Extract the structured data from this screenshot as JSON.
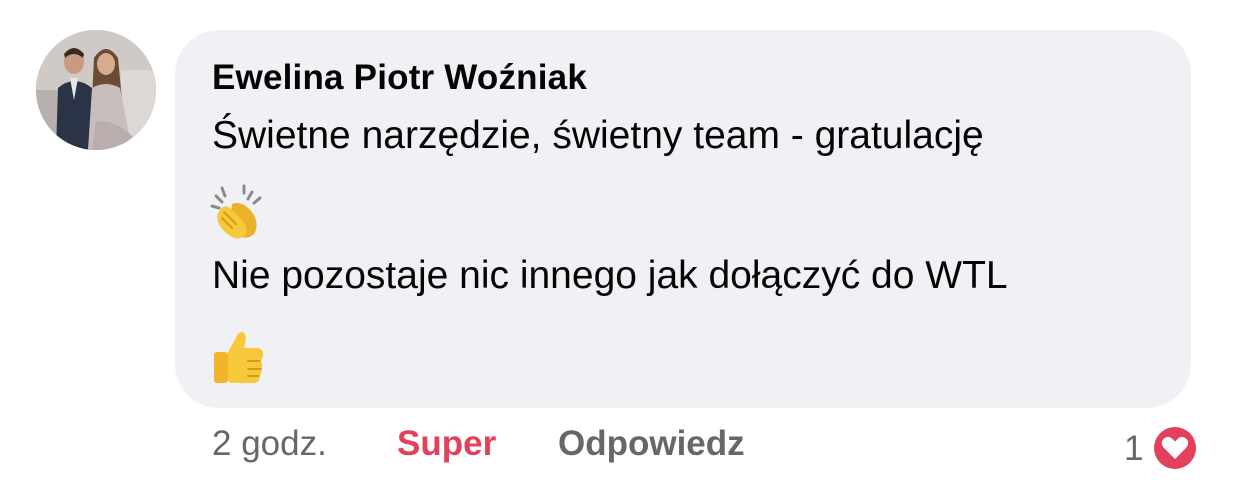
{
  "comment": {
    "author": "Ewelina Piotr Woźniak",
    "line1": "Świetne narzędzie, świetny team - gratulację",
    "emoji1": "clapping-hands-icon",
    "line2": "Nie pozostaje nic innego jak dołączyć do WTL",
    "emoji2": "thumbs-up-icon"
  },
  "actions": {
    "time": "2 godz.",
    "reaction_label": "Super",
    "reply_label": "Odpowiedz",
    "reaction_count": "1",
    "reaction_icon": "heart-icon"
  },
  "colors": {
    "bubble": "#f0f1f4",
    "reaction_accent": "#e2405b",
    "secondary_text": "#65676b",
    "primary_text": "#050505"
  }
}
